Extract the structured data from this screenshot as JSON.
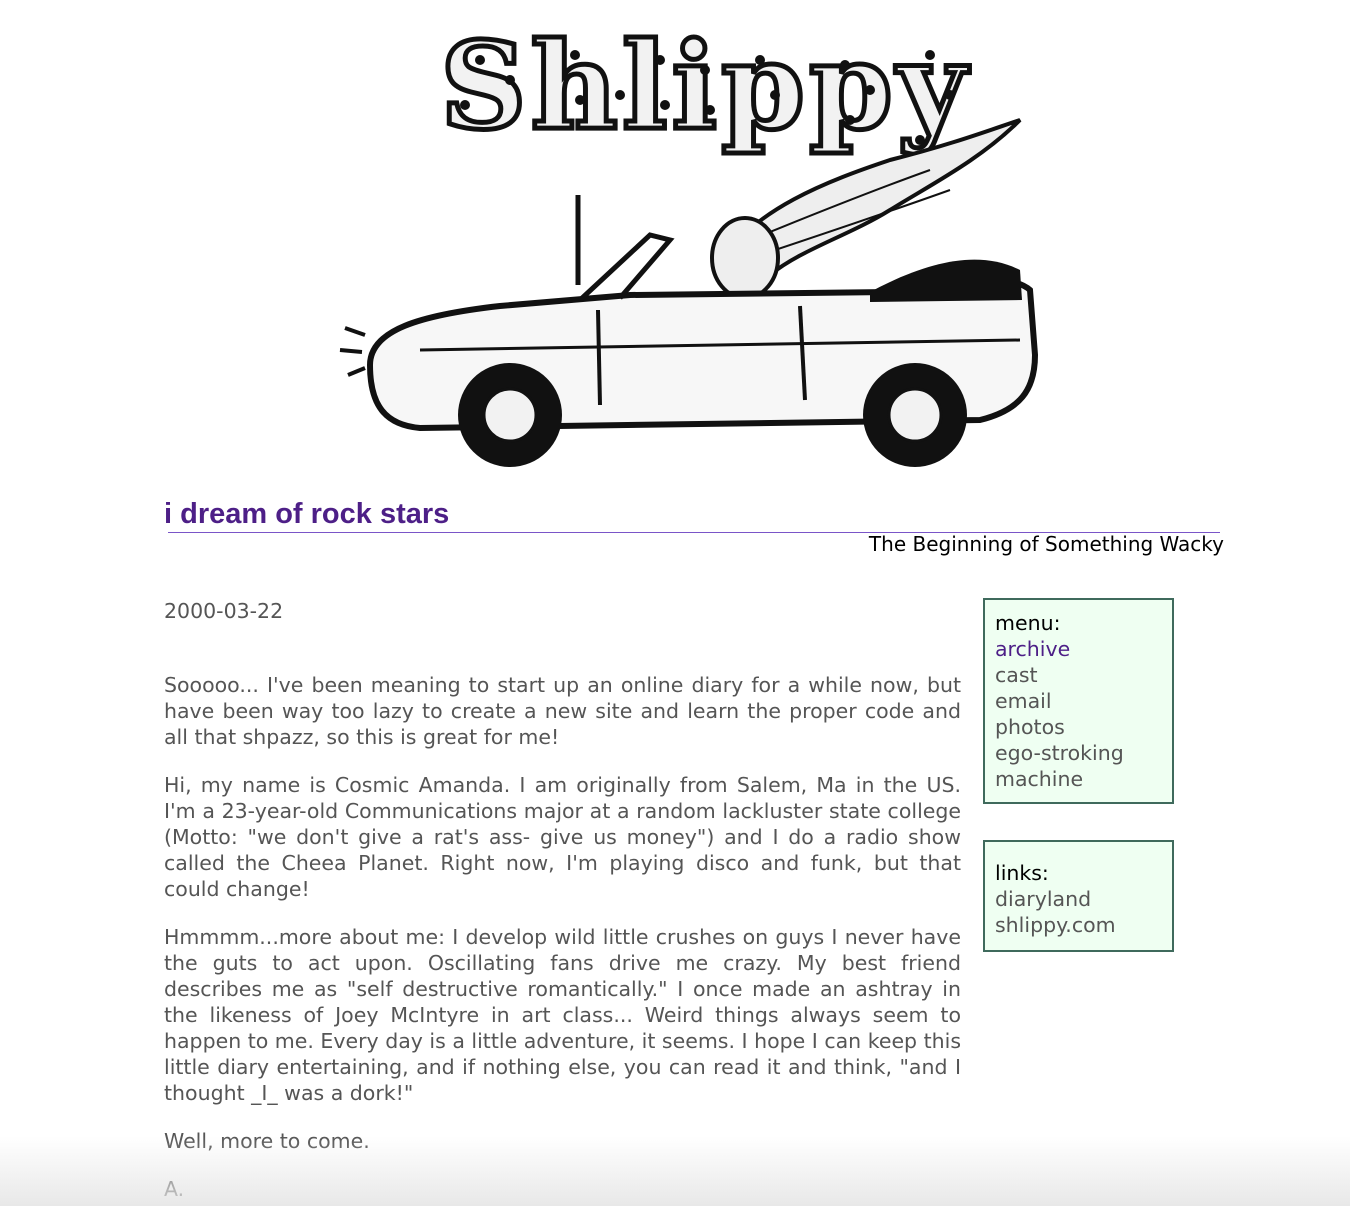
{
  "banner": {
    "logo_text": "Shlippy",
    "image_description_icon": "car-convertible-icon"
  },
  "entry_title": "i dream of rock stars",
  "site_subtitle": "The Beginning of Something Wacky",
  "entry": {
    "date": "2000-03-22",
    "paragraphs": [
      "Sooooo... I've been meaning to start up an online diary for a while now, but have been way too lazy to create a new site and learn the proper code and all that shpazz, so this is great for me!",
      "Hi, my name is Cosmic Amanda. I am originally from Salem, Ma in the US. I'm a 23-year-old Communications major at a random lackluster state college (Motto: \"we don't give a rat's ass- give us money\") and I do a radio show called the Cheea Planet. Right now, I'm playing disco and funk, but that could change!",
      "Hmmmm...more about me: I develop wild little crushes on guys I never have the guts to act upon. Oscillating fans drive me crazy. My best friend describes me as \"self destructive romantically.\" I once made an ashtray in the likeness of Joey McIntyre in art class... Weird things always seem to happen to me. Every day is a little adventure, it seems. I hope I can keep this little diary entertaining, and if nothing else, you can read it and think, \"and I thought _I_ was a dork!\"",
      "Well, more to come.",
      "A."
    ]
  },
  "menu": {
    "heading": "menu:",
    "items": [
      "archive",
      "cast",
      "email",
      "photos",
      "ego-stroking machine"
    ]
  },
  "links": {
    "heading": "links:",
    "items": [
      "diaryland",
      "shlippy.com"
    ]
  },
  "colors": {
    "title": "#4d1f87",
    "body_text": "#555555",
    "box_bg": "#effff2",
    "box_border": "#3f6a5c",
    "rule": "#7a55c8"
  }
}
